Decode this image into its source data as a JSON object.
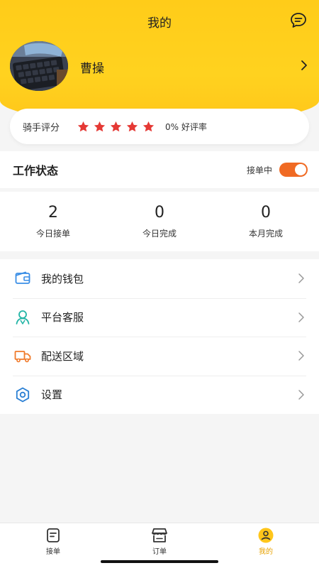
{
  "header": {
    "title": "我的",
    "message_icon": "message-bubble-icon"
  },
  "profile": {
    "username": "曹操",
    "arrow_icon": "chevron-right-icon"
  },
  "rating": {
    "label": "骑手评分",
    "stars": 5,
    "star_color": "#e53935",
    "good_rate": "0% 好评率"
  },
  "work_status": {
    "title": "工作状态",
    "state_text": "接单中",
    "toggle_on": true,
    "toggle_color": "#f06a23"
  },
  "stats": [
    {
      "value": "2",
      "label": "今日接单"
    },
    {
      "value": "0",
      "label": "今日完成"
    },
    {
      "value": "0",
      "label": "本月完成"
    }
  ],
  "menu": [
    {
      "label": "我的钱包",
      "icon": "wallet-icon"
    },
    {
      "label": "平台客服",
      "icon": "customer-service-icon"
    },
    {
      "label": "配送区域",
      "icon": "delivery-truck-icon"
    },
    {
      "label": "设置",
      "icon": "settings-gear-icon"
    }
  ],
  "tabs": [
    {
      "label": "接单",
      "icon": "order-accept-icon",
      "active": false
    },
    {
      "label": "订单",
      "icon": "shop-icon",
      "active": false
    },
    {
      "label": "我的",
      "icon": "user-icon",
      "active": true
    }
  ],
  "colors": {
    "header_yellow": "#ffcc19",
    "active_tab": "#e8a200"
  }
}
